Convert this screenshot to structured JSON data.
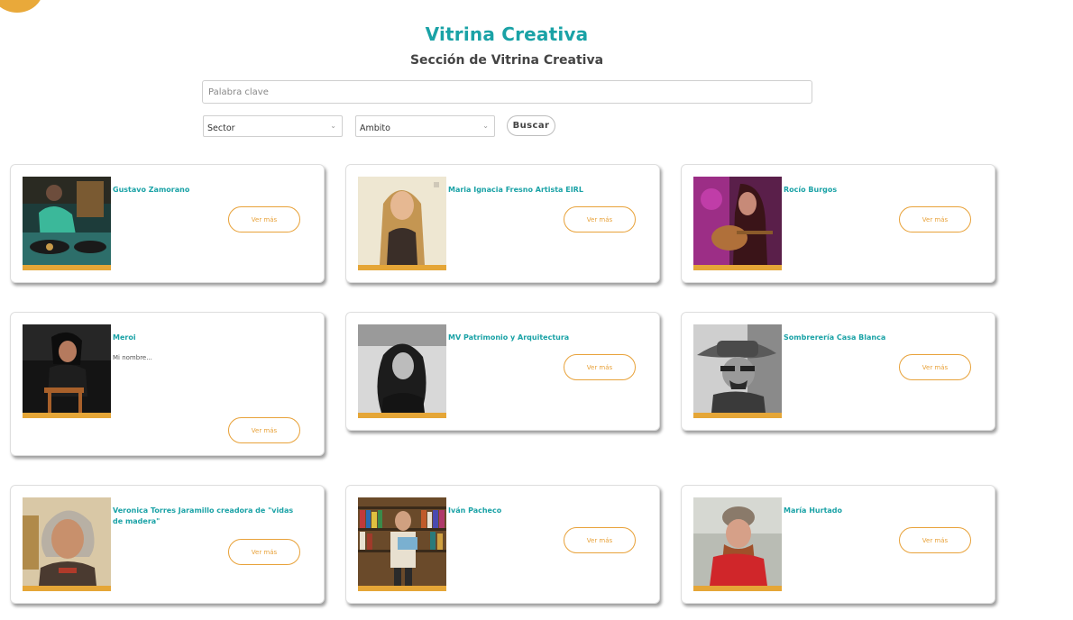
{
  "page": {
    "title": "Vitrina Creativa",
    "subtitle": "Sección de Vitrina Creativa"
  },
  "filters": {
    "keyword_placeholder": "Palabra clave",
    "sector": "Sector",
    "ambito": "Ambito",
    "search_label": "Buscar"
  },
  "colors": {
    "accent": "#1aa2a6",
    "orange": "#e8a23a",
    "photo_bar": "#e5a637"
  },
  "cards": [
    {
      "name": "Gustavo Zamorano",
      "button": "Ver más"
    },
    {
      "name": "Maria Ignacia Fresno Artista EIRL",
      "button": "Ver más"
    },
    {
      "name": "Rocío Burgos",
      "button": "Ver más"
    },
    {
      "name": "Meroi",
      "description": "Mi nombre...",
      "button": "Ver más"
    },
    {
      "name": "MV Patrimonio y Arquitectura",
      "button": "Ver más"
    },
    {
      "name": "Sombrerería Casa Blanca",
      "button": "Ver más"
    },
    {
      "name": "Veronica Torres Jaramillo creadora de \"vidas de madera\"",
      "button": "Ver más"
    },
    {
      "name": "Iván Pacheco",
      "button": "Ver más"
    },
    {
      "name": "María Hurtado",
      "button": "Ver más"
    }
  ]
}
